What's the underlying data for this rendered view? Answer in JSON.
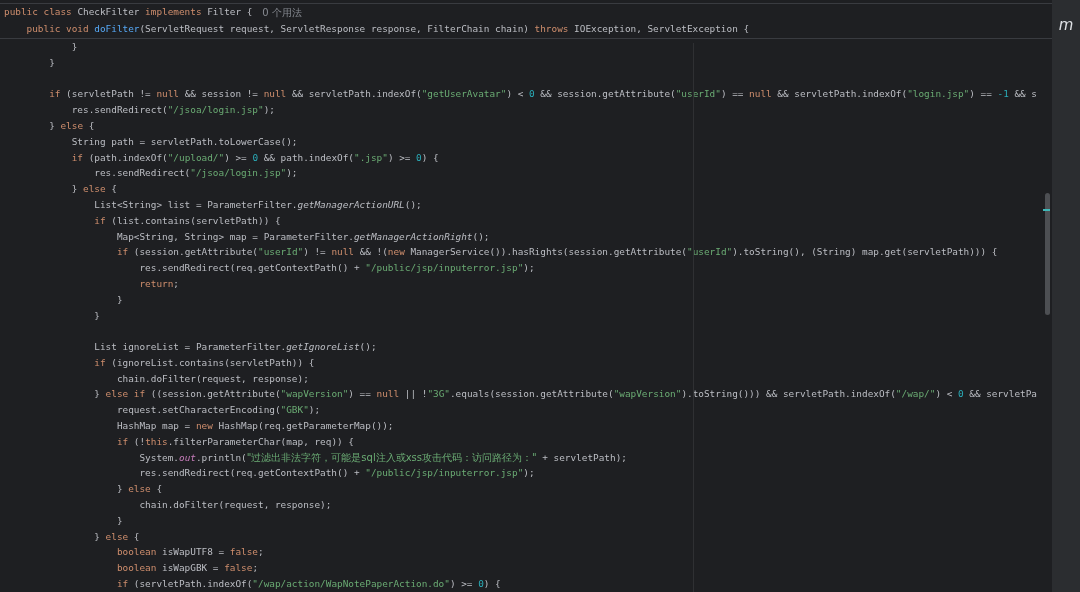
{
  "sticky_header": {
    "lines": [
      {
        "kind": "code",
        "tokens": [
          {
            "kind": "kw",
            "text": "public class "
          },
          {
            "kind": "plain",
            "text": "CheckFilter "
          },
          {
            "kind": "kw",
            "text": "implements "
          },
          {
            "kind": "plain",
            "text": "Filter {"
          }
        ],
        "hint": "0 个用法"
      },
      {
        "kind": "code",
        "tokens": [
          {
            "kind": "kw",
            "text": "    public void "
          },
          {
            "kind": "fn",
            "text": "doFilter"
          },
          {
            "kind": "plain",
            "text": "(ServletRequest request, ServletResponse response, FilterChain chain) "
          },
          {
            "kind": "kw",
            "text": "throws "
          },
          {
            "kind": "plain",
            "text": "IOException, ServletException {"
          }
        ]
      }
    ]
  },
  "editor": {
    "lines": [
      {
        "kind": "code",
        "tokens": [
          {
            "kind": "plain",
            "text": "            }"
          }
        ]
      },
      {
        "kind": "code",
        "tokens": [
          {
            "kind": "plain",
            "text": "        }"
          }
        ]
      },
      {
        "kind": "blank"
      },
      {
        "kind": "code",
        "tokens": [
          {
            "kind": "kw",
            "text": "        if "
          },
          {
            "kind": "plain",
            "text": "(servletPath != "
          },
          {
            "kind": "kw",
            "text": "null"
          },
          {
            "kind": "plain",
            "text": " && session != "
          },
          {
            "kind": "kw",
            "text": "null"
          },
          {
            "kind": "plain",
            "text": " && servletPath.indexOf("
          },
          {
            "kind": "str",
            "text": "\"getUserAvatar\""
          },
          {
            "kind": "plain",
            "text": ") < "
          },
          {
            "kind": "num",
            "text": "0"
          },
          {
            "kind": "plain",
            "text": " && session.getAttribute("
          },
          {
            "kind": "str",
            "text": "\"userId\""
          },
          {
            "kind": "plain",
            "text": ") == "
          },
          {
            "kind": "kw",
            "text": "null"
          },
          {
            "kind": "plain",
            "text": " && servletPath.indexOf("
          },
          {
            "kind": "str",
            "text": "\"login.jsp\""
          },
          {
            "kind": "plain",
            "text": ") == "
          },
          {
            "kind": "num",
            "text": "-1"
          },
          {
            "kind": "plain",
            "text": " && s"
          }
        ]
      },
      {
        "kind": "code",
        "tokens": [
          {
            "kind": "plain",
            "text": "            res.sendRedirect("
          },
          {
            "kind": "str",
            "text": "\"/jsoa/login.jsp\""
          },
          {
            "kind": "plain",
            "text": ");"
          }
        ]
      },
      {
        "kind": "code",
        "tokens": [
          {
            "kind": "plain",
            "text": "        } "
          },
          {
            "kind": "kw",
            "text": "else "
          },
          {
            "kind": "plain",
            "text": "{"
          }
        ]
      },
      {
        "kind": "code",
        "tokens": [
          {
            "kind": "plain",
            "text": "            String path = servletPath.toLowerCase();"
          }
        ]
      },
      {
        "kind": "code",
        "tokens": [
          {
            "kind": "kw",
            "text": "            if "
          },
          {
            "kind": "plain",
            "text": "(path.indexOf("
          },
          {
            "kind": "str",
            "text": "\"/upload/\""
          },
          {
            "kind": "plain",
            "text": ") >= "
          },
          {
            "kind": "num",
            "text": "0"
          },
          {
            "kind": "plain",
            "text": " && path.indexOf("
          },
          {
            "kind": "str",
            "text": "\".jsp\""
          },
          {
            "kind": "plain",
            "text": ") >= "
          },
          {
            "kind": "num",
            "text": "0"
          },
          {
            "kind": "plain",
            "text": ") {"
          }
        ]
      },
      {
        "kind": "code",
        "tokens": [
          {
            "kind": "plain",
            "text": "                res.sendRedirect("
          },
          {
            "kind": "str",
            "text": "\"/jsoa/login.jsp\""
          },
          {
            "kind": "plain",
            "text": ");"
          }
        ]
      },
      {
        "kind": "code",
        "tokens": [
          {
            "kind": "plain",
            "text": "            } "
          },
          {
            "kind": "kw",
            "text": "else "
          },
          {
            "kind": "plain",
            "text": "{"
          }
        ]
      },
      {
        "kind": "code",
        "tokens": [
          {
            "kind": "plain",
            "text": "                List<String> list = ParameterFilter."
          },
          {
            "kind": "static",
            "text": "getManagerActionURL"
          },
          {
            "kind": "plain",
            "text": "();"
          }
        ]
      },
      {
        "kind": "code",
        "tokens": [
          {
            "kind": "kw",
            "text": "                if "
          },
          {
            "kind": "plain",
            "text": "(list.contains(servletPath)) {"
          }
        ]
      },
      {
        "kind": "code",
        "tokens": [
          {
            "kind": "plain",
            "text": "                    Map<String, String> map = ParameterFilter."
          },
          {
            "kind": "static",
            "text": "getManagerActionRight"
          },
          {
            "kind": "plain",
            "text": "();"
          }
        ]
      },
      {
        "kind": "code",
        "tokens": [
          {
            "kind": "kw",
            "text": "                    if "
          },
          {
            "kind": "plain",
            "text": "(session.getAttribute("
          },
          {
            "kind": "str",
            "text": "\"userId\""
          },
          {
            "kind": "plain",
            "text": ") != "
          },
          {
            "kind": "kw",
            "text": "null"
          },
          {
            "kind": "plain",
            "text": " && !("
          },
          {
            "kind": "kw",
            "text": "new "
          },
          {
            "kind": "plain",
            "text": "ManagerService()).hasRights(session.getAttribute("
          },
          {
            "kind": "str",
            "text": "\"userId\""
          },
          {
            "kind": "plain",
            "text": ").toString(), (String) map.get(servletPath))) {"
          }
        ]
      },
      {
        "kind": "code",
        "tokens": [
          {
            "kind": "plain",
            "text": "                        res.sendRedirect(req.getContextPath() + "
          },
          {
            "kind": "str",
            "text": "\"/public/jsp/inputerror.jsp\""
          },
          {
            "kind": "plain",
            "text": ");"
          }
        ]
      },
      {
        "kind": "code",
        "tokens": [
          {
            "kind": "kw",
            "text": "                        return"
          },
          {
            "kind": "plain",
            "text": ";"
          }
        ]
      },
      {
        "kind": "code",
        "tokens": [
          {
            "kind": "plain",
            "text": "                    }"
          }
        ]
      },
      {
        "kind": "code",
        "tokens": [
          {
            "kind": "plain",
            "text": "                }"
          }
        ]
      },
      {
        "kind": "blank"
      },
      {
        "kind": "code",
        "tokens": [
          {
            "kind": "plain",
            "text": "                List ignoreList = ParameterFilter."
          },
          {
            "kind": "static",
            "text": "getIgnoreList"
          },
          {
            "kind": "plain",
            "text": "();"
          }
        ]
      },
      {
        "kind": "code",
        "tokens": [
          {
            "kind": "kw",
            "text": "                if "
          },
          {
            "kind": "plain",
            "text": "(ignoreList.contains(servletPath)) {"
          }
        ]
      },
      {
        "kind": "code",
        "tokens": [
          {
            "kind": "plain",
            "text": "                    chain.doFilter(request, response);"
          }
        ]
      },
      {
        "kind": "code",
        "tokens": [
          {
            "kind": "plain",
            "text": "                } "
          },
          {
            "kind": "kw",
            "text": "else if "
          },
          {
            "kind": "plain",
            "text": "((session.getAttribute("
          },
          {
            "kind": "str",
            "text": "\"wapVersion\""
          },
          {
            "kind": "plain",
            "text": ") == "
          },
          {
            "kind": "kw",
            "text": "null"
          },
          {
            "kind": "plain",
            "text": " || !"
          },
          {
            "kind": "str",
            "text": "\"3G\""
          },
          {
            "kind": "plain",
            "text": ".equals(session.getAttribute("
          },
          {
            "kind": "str",
            "text": "\"wapVersion\""
          },
          {
            "kind": "plain",
            "text": ").toString())) && servletPath.indexOf("
          },
          {
            "kind": "str",
            "text": "\"/wap/\""
          },
          {
            "kind": "plain",
            "text": ") < "
          },
          {
            "kind": "num",
            "text": "0"
          },
          {
            "kind": "plain",
            "text": " && servletPa"
          }
        ]
      },
      {
        "kind": "code",
        "tokens": [
          {
            "kind": "plain",
            "text": "                    request.setCharacterEncoding("
          },
          {
            "kind": "str",
            "text": "\"GBK\""
          },
          {
            "kind": "plain",
            "text": ");"
          }
        ]
      },
      {
        "kind": "code",
        "tokens": [
          {
            "kind": "plain",
            "text": "                    HashMap map = "
          },
          {
            "kind": "kw",
            "text": "new "
          },
          {
            "kind": "plain",
            "text": "HashMap(req.getParameterMap());"
          }
        ]
      },
      {
        "kind": "code",
        "tokens": [
          {
            "kind": "kw",
            "text": "                    if "
          },
          {
            "kind": "plain",
            "text": "(!"
          },
          {
            "kind": "kw",
            "text": "this"
          },
          {
            "kind": "plain",
            "text": ".filterParameterChar(map, req)) {"
          }
        ]
      },
      {
        "kind": "code",
        "tokens": [
          {
            "kind": "plain",
            "text": "                        System."
          },
          {
            "kind": "field",
            "text": "out"
          },
          {
            "kind": "plain",
            "text": ".println("
          },
          {
            "kind": "cjkstr",
            "text": "\"过滤出非法字符，可能是sql注入或xss攻击代码：访问路径为：\""
          },
          {
            "kind": "plain",
            "text": " + servletPath);"
          }
        ]
      },
      {
        "kind": "code",
        "tokens": [
          {
            "kind": "plain",
            "text": "                        res.sendRedirect(req.getContextPath() + "
          },
          {
            "kind": "str",
            "text": "\"/public/jsp/inputerror.jsp\""
          },
          {
            "kind": "plain",
            "text": ");"
          }
        ]
      },
      {
        "kind": "code",
        "tokens": [
          {
            "kind": "plain",
            "text": "                    } "
          },
          {
            "kind": "kw",
            "text": "else "
          },
          {
            "kind": "plain",
            "text": "{"
          }
        ]
      },
      {
        "kind": "code",
        "tokens": [
          {
            "kind": "plain",
            "text": "                        chain.doFilter(request, response);"
          }
        ]
      },
      {
        "kind": "code",
        "tokens": [
          {
            "kind": "plain",
            "text": "                    }"
          }
        ]
      },
      {
        "kind": "code",
        "tokens": [
          {
            "kind": "plain",
            "text": "                } "
          },
          {
            "kind": "kw",
            "text": "else "
          },
          {
            "kind": "plain",
            "text": "{"
          }
        ]
      },
      {
        "kind": "code",
        "tokens": [
          {
            "kind": "kw",
            "text": "                    boolean "
          },
          {
            "kind": "plain",
            "text": "isWapUTF8 = "
          },
          {
            "kind": "kw",
            "text": "false"
          },
          {
            "kind": "plain",
            "text": ";"
          }
        ]
      },
      {
        "kind": "code",
        "tokens": [
          {
            "kind": "kw",
            "text": "                    boolean "
          },
          {
            "kind": "plain",
            "text": "isWapGBK = "
          },
          {
            "kind": "kw",
            "text": "false"
          },
          {
            "kind": "plain",
            "text": ";"
          }
        ]
      },
      {
        "kind": "code",
        "tokens": [
          {
            "kind": "kw",
            "text": "                    if "
          },
          {
            "kind": "plain",
            "text": "(servletPath.indexOf("
          },
          {
            "kind": "str",
            "text": "\"/wap/action/WapNotePaperAction.do\""
          },
          {
            "kind": "plain",
            "text": ") >= "
          },
          {
            "kind": "num",
            "text": "0"
          },
          {
            "kind": "plain",
            "text": ") {"
          }
        ]
      }
    ]
  },
  "side_panel": {
    "label": "m"
  }
}
